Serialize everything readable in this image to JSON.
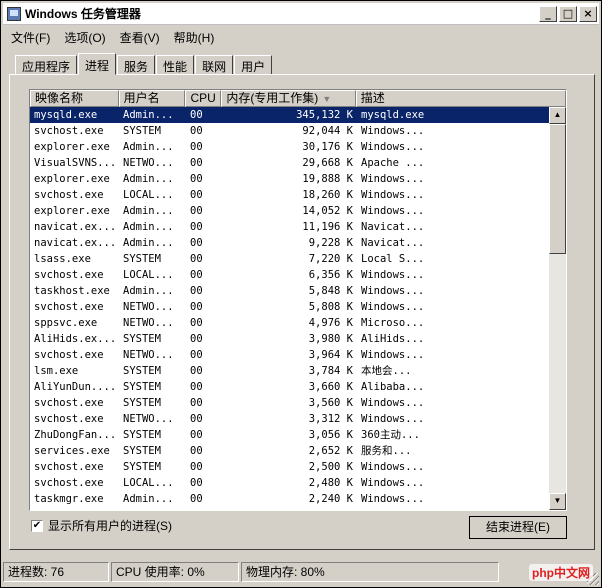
{
  "window": {
    "title": "Windows 任务管理器"
  },
  "menu": [
    "文件(F)",
    "选项(O)",
    "查看(V)",
    "帮助(H)"
  ],
  "tabs": [
    "应用程序",
    "进程",
    "服务",
    "性能",
    "联网",
    "用户"
  ],
  "active_tab": 1,
  "columns": [
    "映像名称",
    "用户名",
    "CPU",
    "内存(专用工作集)",
    "描述"
  ],
  "rows": [
    {
      "name": "mysqld.exe",
      "user": "Admin...",
      "cpu": "00",
      "mem": "345,132 K",
      "desc": "mysqld.exe"
    },
    {
      "name": "svchost.exe",
      "user": "SYSTEM",
      "cpu": "00",
      "mem": "92,044 K",
      "desc": "Windows..."
    },
    {
      "name": "explorer.exe",
      "user": "Admin...",
      "cpu": "00",
      "mem": "30,176 K",
      "desc": "Windows..."
    },
    {
      "name": "VisualSVNS...",
      "user": "NETWO...",
      "cpu": "00",
      "mem": "29,668 K",
      "desc": "Apache ..."
    },
    {
      "name": "explorer.exe",
      "user": "Admin...",
      "cpu": "00",
      "mem": "19,888 K",
      "desc": "Windows..."
    },
    {
      "name": "svchost.exe",
      "user": "LOCAL...",
      "cpu": "00",
      "mem": "18,260 K",
      "desc": "Windows..."
    },
    {
      "name": "explorer.exe",
      "user": "Admin...",
      "cpu": "00",
      "mem": "14,052 K",
      "desc": "Windows..."
    },
    {
      "name": "navicat.ex...",
      "user": "Admin...",
      "cpu": "00",
      "mem": "11,196 K",
      "desc": "Navicat..."
    },
    {
      "name": "navicat.ex...",
      "user": "Admin...",
      "cpu": "00",
      "mem": "9,228 K",
      "desc": "Navicat..."
    },
    {
      "name": "lsass.exe",
      "user": "SYSTEM",
      "cpu": "00",
      "mem": "7,220 K",
      "desc": "Local S..."
    },
    {
      "name": "svchost.exe",
      "user": "LOCAL...",
      "cpu": "00",
      "mem": "6,356 K",
      "desc": "Windows..."
    },
    {
      "name": "taskhost.exe",
      "user": "Admin...",
      "cpu": "00",
      "mem": "5,848 K",
      "desc": "Windows..."
    },
    {
      "name": "svchost.exe",
      "user": "NETWO...",
      "cpu": "00",
      "mem": "5,808 K",
      "desc": "Windows..."
    },
    {
      "name": "sppsvc.exe",
      "user": "NETWO...",
      "cpu": "00",
      "mem": "4,976 K",
      "desc": "Microso..."
    },
    {
      "name": "AliHids.ex...",
      "user": "SYSTEM",
      "cpu": "00",
      "mem": "3,980 K",
      "desc": "AliHids..."
    },
    {
      "name": "svchost.exe",
      "user": "NETWO...",
      "cpu": "00",
      "mem": "3,964 K",
      "desc": "Windows..."
    },
    {
      "name": "lsm.exe",
      "user": "SYSTEM",
      "cpu": "00",
      "mem": "3,784 K",
      "desc": "本地会..."
    },
    {
      "name": "AliYunDun....",
      "user": "SYSTEM",
      "cpu": "00",
      "mem": "3,660 K",
      "desc": "Alibaba..."
    },
    {
      "name": "svchost.exe",
      "user": "SYSTEM",
      "cpu": "00",
      "mem": "3,560 K",
      "desc": "Windows..."
    },
    {
      "name": "svchost.exe",
      "user": "NETWO...",
      "cpu": "00",
      "mem": "3,312 K",
      "desc": "Windows..."
    },
    {
      "name": "ZhuDongFan...",
      "user": "SYSTEM",
      "cpu": "00",
      "mem": "3,056 K",
      "desc": "360主动..."
    },
    {
      "name": "services.exe",
      "user": "SYSTEM",
      "cpu": "00",
      "mem": "2,652 K",
      "desc": "服务和..."
    },
    {
      "name": "svchost.exe",
      "user": "SYSTEM",
      "cpu": "00",
      "mem": "2,500 K",
      "desc": "Windows..."
    },
    {
      "name": "svchost.exe",
      "user": "LOCAL...",
      "cpu": "00",
      "mem": "2,480 K",
      "desc": "Windows..."
    },
    {
      "name": "taskmgr.exe",
      "user": "Admin...",
      "cpu": "00",
      "mem": "2,240 K",
      "desc": "Windows..."
    }
  ],
  "selected_row": 0,
  "show_all_users": {
    "label": "显示所有用户的进程(S)",
    "checked": true
  },
  "end_process_label": "结束进程(E)",
  "status": {
    "processes": "进程数: 76",
    "cpu": "CPU 使用率: 0%",
    "memory": "物理内存: 80%"
  },
  "watermark": "php中文网",
  "icons": {
    "sort": "sort-down-arrow-icon",
    "check": "check-icon"
  }
}
